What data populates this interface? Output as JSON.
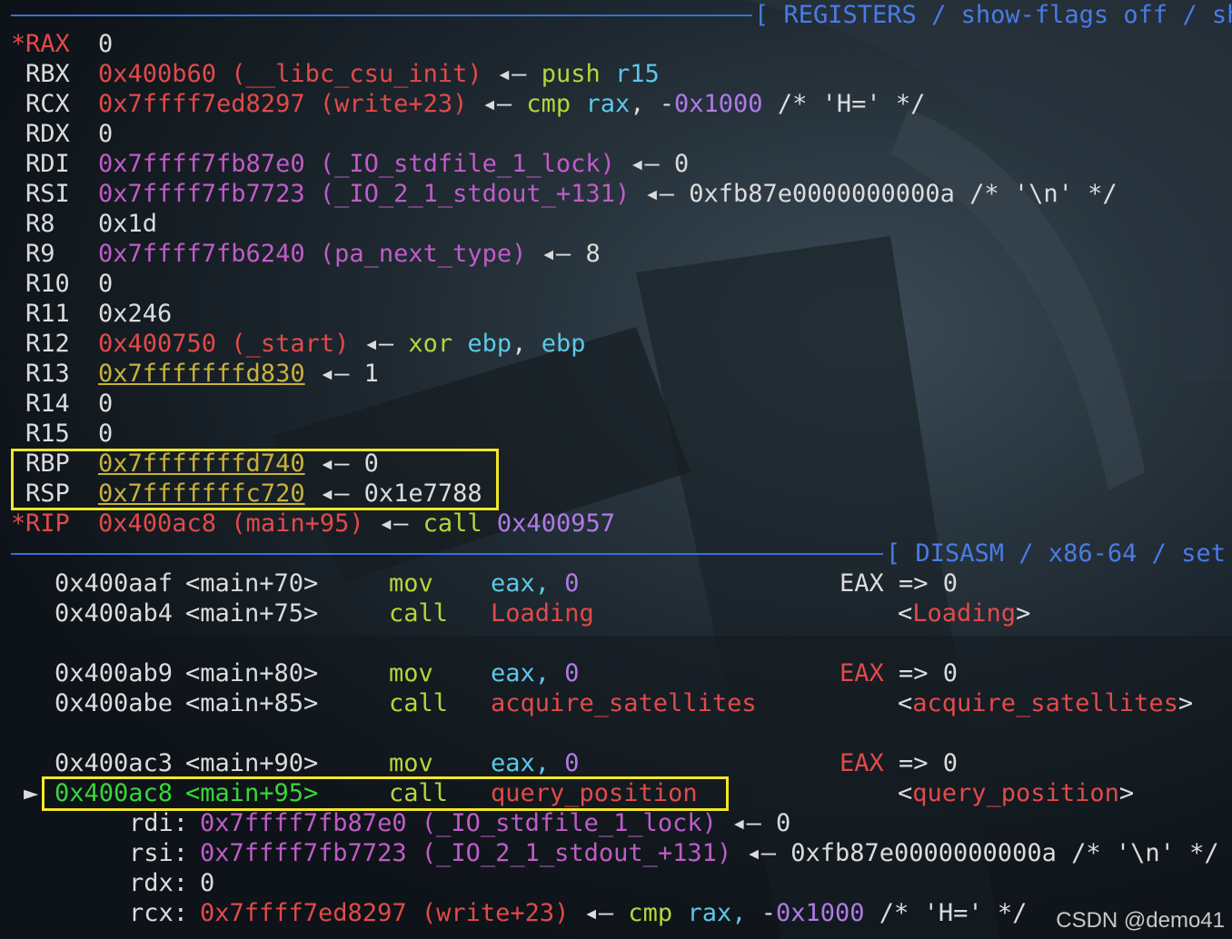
{
  "registers_header": "[ REGISTERS / show-flags off / sh",
  "disasm_header": "[ DISASM / x86-64 / set",
  "registers": [
    {
      "mark": "*",
      "name": "RAX",
      "value": "0",
      "ann": ""
    },
    {
      "mark": " ",
      "name": "RBX",
      "value": "0x400b60",
      "sym": "(__libc_csu_init)",
      "arrow": "◂—",
      "ins_op": "push",
      "ins_args": "r15"
    },
    {
      "mark": " ",
      "name": "RCX",
      "value": "0x7ffff7ed8297",
      "sym": "(write+23)",
      "arrow": "◂—",
      "ins_op": "cmp",
      "ins_args": "rax, -0x1000",
      "comment": "/* 'H=' */"
    },
    {
      "mark": " ",
      "name": "RDX",
      "value": "0"
    },
    {
      "mark": " ",
      "name": "RDI",
      "value": "0x7ffff7fb87e0",
      "sym": "(_IO_stdfile_1_lock)",
      "arrow": "◂—",
      "deref": "0"
    },
    {
      "mark": " ",
      "name": "RSI",
      "value": "0x7ffff7fb7723",
      "sym": "(_IO_2_1_stdout_+131)",
      "arrow": "◂—",
      "deref": "0xfb87e0000000000a",
      "comment": "/* '\\n' */"
    },
    {
      "mark": " ",
      "name": "R8",
      "value": "0x1d"
    },
    {
      "mark": " ",
      "name": "R9",
      "value": "0x7ffff7fb6240",
      "sym": "(pa_next_type)",
      "arrow": "◂—",
      "deref": "8"
    },
    {
      "mark": " ",
      "name": "R10",
      "value": "0"
    },
    {
      "mark": " ",
      "name": "R11",
      "value": "0x246"
    },
    {
      "mark": " ",
      "name": "R12",
      "value": "0x400750",
      "sym": "(_start)",
      "arrow": "◂—",
      "ins_op": "xor",
      "ins_args": "ebp, ebp"
    },
    {
      "mark": " ",
      "name": "R13",
      "value": "0x7fffffffd830",
      "arrow": "◂—",
      "deref": "1"
    },
    {
      "mark": " ",
      "name": "R14",
      "value": "0"
    },
    {
      "mark": " ",
      "name": "R15",
      "value": "0"
    },
    {
      "mark": " ",
      "name": "RBP",
      "value": "0x7fffffffd740",
      "arrow": "◂—",
      "deref": "0"
    },
    {
      "mark": " ",
      "name": "RSP",
      "value": "0x7fffffffc720",
      "arrow": "◂—",
      "deref": "0x1e7788"
    },
    {
      "mark": "*",
      "name": "RIP",
      "value": "0x400ac8",
      "sym": "(main+95)",
      "arrow": "◂—",
      "ins_op": "call",
      "ins_args": "0x400957"
    }
  ],
  "disasm": [
    {
      "addr": "0x400aaf",
      "loc": "<main+70>",
      "op": "mov",
      "args_reg": "eax,",
      "args_num": "0",
      "note_reg": "EAX",
      "note_rest": "=> 0"
    },
    {
      "addr": "0x400ab4",
      "loc": "<main+75>",
      "op": "call",
      "target": "Loading",
      "note_fn": "Loading"
    },
    {
      "addr": "0x400ab9",
      "loc": "<main+80>",
      "op": "mov",
      "args_reg": "eax,",
      "args_num": "0",
      "note_reg": "EAX",
      "note_rest": "=> 0"
    },
    {
      "addr": "0x400abe",
      "loc": "<main+85>",
      "op": "call",
      "target": "acquire_satellites",
      "note_fn": "acquire_satellites"
    },
    {
      "addr": "0x400ac3",
      "loc": "<main+90>",
      "op": "mov",
      "args_reg": "eax,",
      "args_num": "0",
      "note_reg": "EAX",
      "note_rest": "=> 0"
    },
    {
      "addr": "0x400ac8",
      "loc": "<main+95>",
      "op": "call",
      "target": "query_position",
      "note_fn": "query_position",
      "current": true
    }
  ],
  "args": [
    {
      "name": "rdi:",
      "value": "0x7ffff7fb87e0",
      "sym": "(_IO_stdfile_1_lock)",
      "arrow": "◂—",
      "deref": "0"
    },
    {
      "name": "rsi:",
      "value": "0x7ffff7fb7723",
      "sym": "(_IO_2_1_stdout_+131)",
      "arrow": "◂—",
      "deref": "0xfb87e0000000000a",
      "comment": "/* '\\n' */"
    },
    {
      "name": "rdx:",
      "value": "0"
    },
    {
      "name": "rcx:",
      "value": "0x7ffff7ed8297",
      "sym": "(write+23)",
      "arrow": "◂—",
      "ins_op": "cmp",
      "ins_args_reg": "rax,",
      "ins_args_num": "-0x1000",
      "comment": "/* 'H=' */"
    }
  ],
  "current_marker": "►",
  "watermark": "CSDN @demo41"
}
